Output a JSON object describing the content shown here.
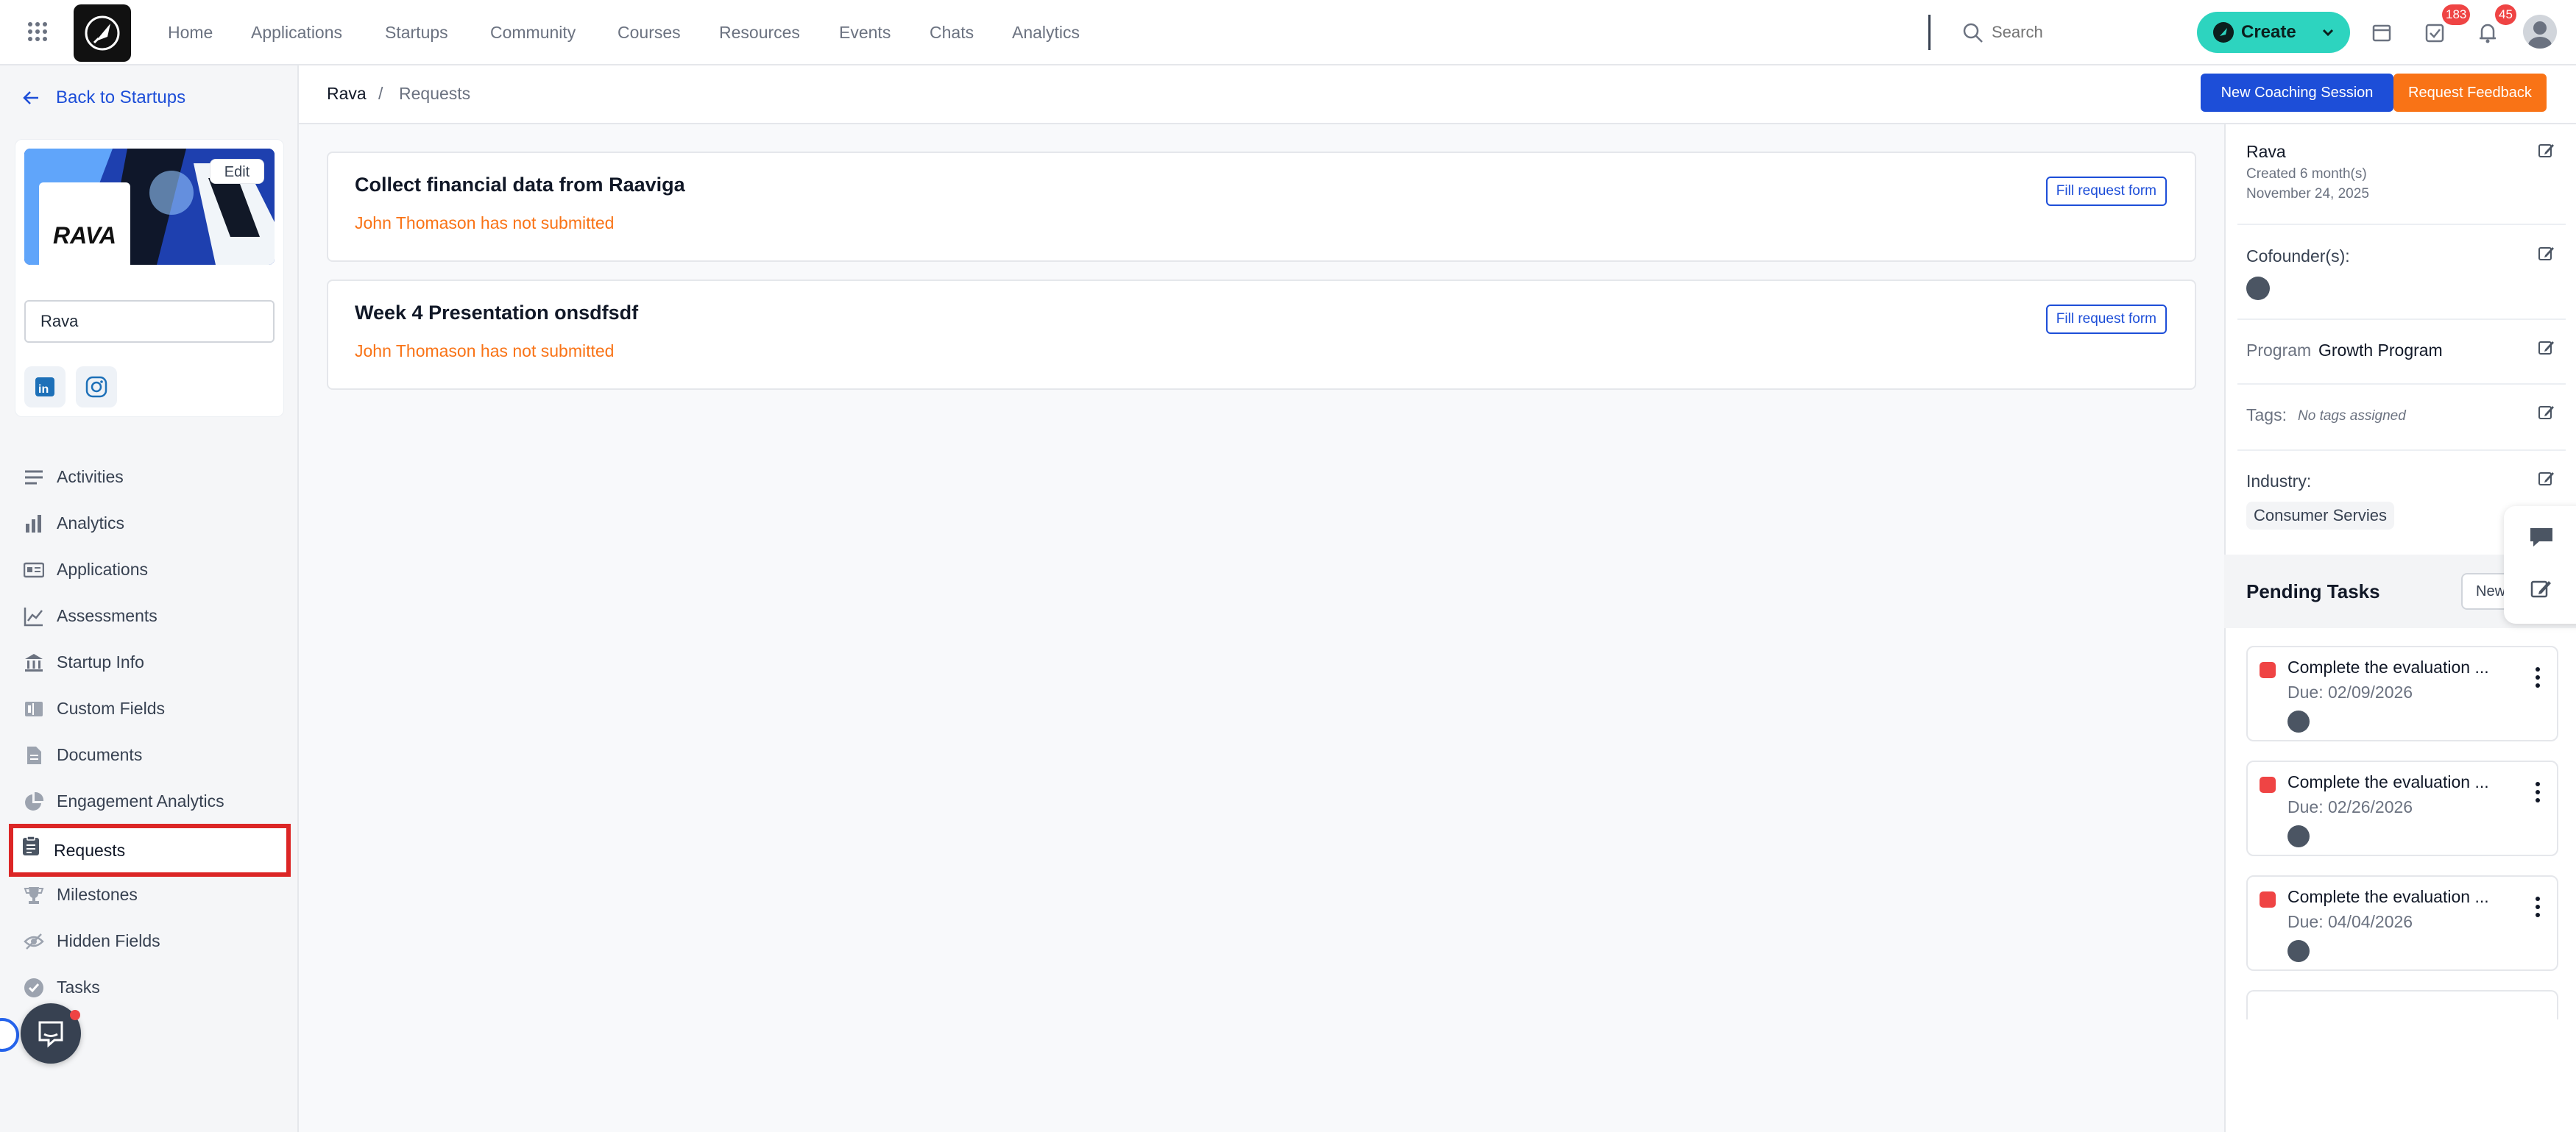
{
  "nav": {
    "items": [
      "Home",
      "Applications",
      "Startups",
      "Community",
      "Courses",
      "Resources",
      "Events",
      "Chats",
      "Analytics"
    ],
    "search_placeholder": "Search",
    "create_label": "Create",
    "tasks_badge": "183",
    "notifications_badge": "45"
  },
  "sidebar": {
    "back_label": "Back to Startups",
    "edit_label": "Edit",
    "logo_text": "RAVA",
    "startup_name": "Rava",
    "menu": [
      {
        "label": "Activities",
        "icon": "list-icon"
      },
      {
        "label": "Analytics",
        "icon": "bar-chart-icon"
      },
      {
        "label": "Applications",
        "icon": "id-card-icon"
      },
      {
        "label": "Assessments",
        "icon": "line-chart-icon"
      },
      {
        "label": "Startup Info",
        "icon": "bank-icon"
      },
      {
        "label": "Custom Fields",
        "icon": "fields-icon"
      },
      {
        "label": "Documents",
        "icon": "document-icon"
      },
      {
        "label": "Engagement Analytics",
        "icon": "pie-chart-icon"
      },
      {
        "label": "Requests",
        "icon": "clipboard-icon",
        "active": true
      },
      {
        "label": "Milestones",
        "icon": "trophy-icon"
      },
      {
        "label": "Hidden Fields",
        "icon": "eye-slash-icon"
      },
      {
        "label": "Tasks",
        "icon": "check-circle-icon"
      }
    ]
  },
  "breadcrumb": {
    "root": "Rava",
    "separator": "/",
    "current": "Requests"
  },
  "header_buttons": {
    "coaching": "New Coaching Session",
    "feedback": "Request Feedback"
  },
  "requests": [
    {
      "title": "Collect financial data from Raaviga",
      "status": "John Thomason has not submitted",
      "button": "Fill request form"
    },
    {
      "title": "Week 4 Presentation onsdfsdf",
      "status": "John Thomason has not submitted",
      "button": "Fill request form"
    }
  ],
  "details": {
    "name": "Rava",
    "created": "Created 6 month(s)",
    "date": "November 24, 2025",
    "cofounders_label": "Cofounder(s):",
    "program_label": "Program",
    "program_value": "Growth Program",
    "tags_label": "Tags:",
    "tags_value": "No tags assigned",
    "industry_label": "Industry:",
    "industry_value": "Consumer Servies"
  },
  "pending_tasks": {
    "title": "Pending Tasks",
    "new_label": "New",
    "items": [
      {
        "title": "Complete the evaluation ...",
        "due": "Due: 02/09/2026"
      },
      {
        "title": "Complete the evaluation ...",
        "due": "Due: 02/26/2026"
      },
      {
        "title": "Complete the evaluation ...",
        "due": "Due: 04/04/2026"
      }
    ]
  },
  "colors": {
    "accent": "#1d4ed8",
    "create": "#2dd4bf",
    "feedback": "#f97316",
    "warning_text": "#f97316",
    "highlight": "#dc2626"
  }
}
